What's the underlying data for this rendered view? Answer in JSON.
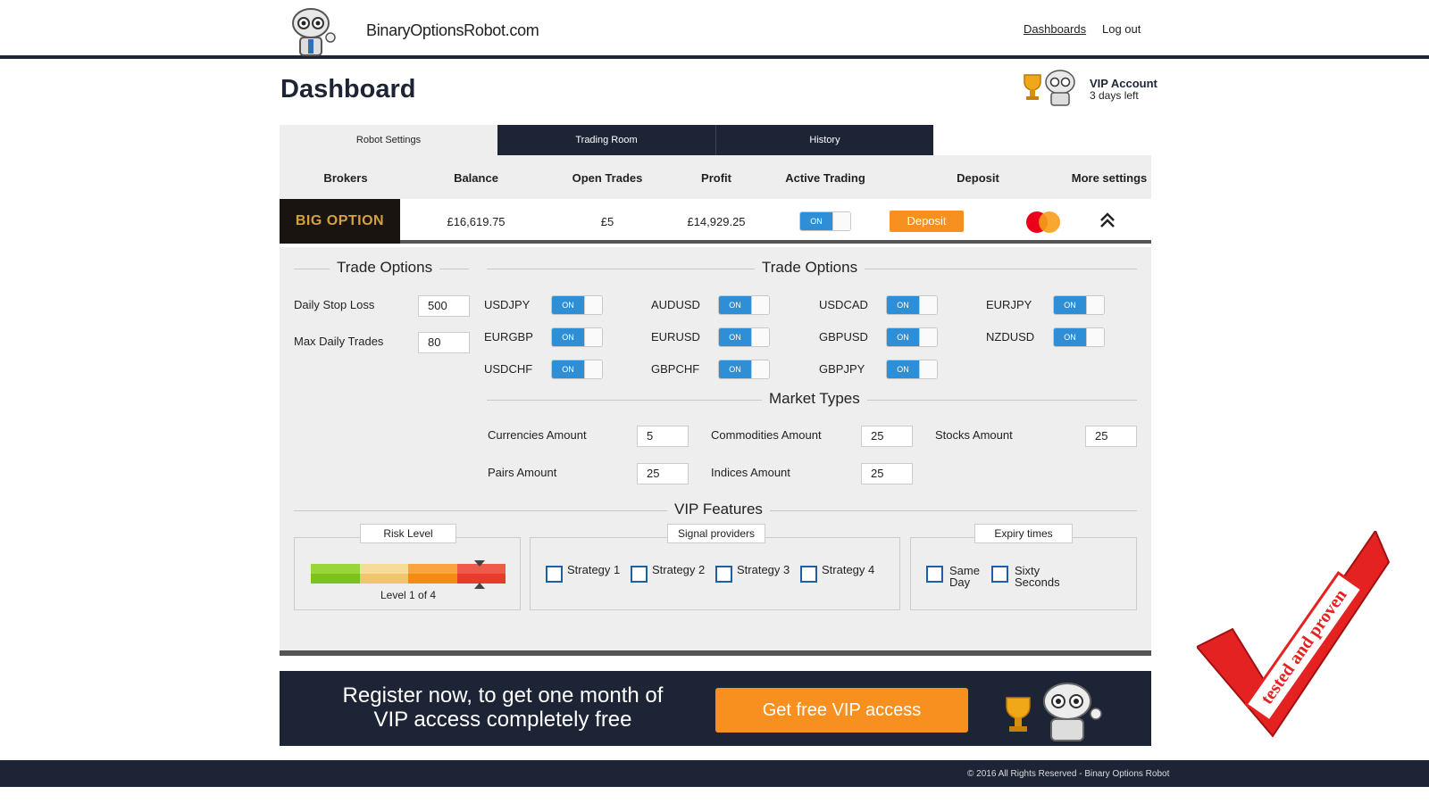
{
  "header": {
    "logo_text": "BinaryOptionsRobot.com",
    "nav": {
      "dashboards": "Dashboards",
      "logout": "Log out"
    }
  },
  "page": {
    "title": "Dashboard",
    "vip_account": "VIP Account",
    "vip_days_left": "3 days left"
  },
  "tabs": [
    "Robot Settings",
    "Trading Room",
    "History"
  ],
  "brokers_table": {
    "headers": [
      "Brokers",
      "Balance",
      "Open Trades",
      "Profit",
      "Active Trading",
      "Deposit",
      "More settings"
    ],
    "row": {
      "broker_name": "BIG OPTION",
      "balance": "£16,619.75",
      "open_trades": "£5",
      "profit": "£14,929.25",
      "active_trading": "ON",
      "deposit_button": "Deposit"
    }
  },
  "trade_options": {
    "title_left": "Trade Options",
    "title_right": "Trade Options",
    "daily_stop_loss_label": "Daily Stop Loss",
    "daily_stop_loss_value": "500",
    "max_daily_trades_label": "Max Daily Trades",
    "max_daily_trades_value": "80",
    "toggle_label": "ON",
    "pairs": [
      "USDJPY",
      "AUDUSD",
      "USDCAD",
      "EURJPY",
      "EURGBP",
      "EURUSD",
      "GBPUSD",
      "NZDUSD",
      "USDCHF",
      "GBPCHF",
      "GBPJPY"
    ]
  },
  "market_types": {
    "title": "Market Types",
    "currencies_label": "Currencies Amount",
    "currencies_value": "5",
    "commodities_label": "Commodities Amount",
    "commodities_value": "25",
    "stocks_label": "Stocks Amount",
    "stocks_value": "25",
    "pairs_label": "Pairs Amount",
    "pairs_value": "25",
    "indices_label": "Indices Amount",
    "indices_value": "25"
  },
  "vip_features": {
    "title": "VIP Features",
    "risk_level_label": "Risk Level",
    "risk_level_text": "Level 1 of 4",
    "risk_level_value": 1,
    "risk_level_max": 4,
    "signal_providers_label": "Signal providers",
    "strategies": [
      "Strategy 1",
      "Strategy 2",
      "Strategy 3",
      "Strategy 4"
    ],
    "expiry_times_label": "Expiry times",
    "expiry_same": "Same",
    "expiry_day": "Day",
    "expiry_sixty": "Sixty",
    "expiry_seconds": "Seconds"
  },
  "banner": {
    "line1": "Register now, to get one month of",
    "line2": "VIP access completely free",
    "cta": "Get free VIP access"
  },
  "footer": {
    "copyright": "© 2016 All Rights Reserved - Binary Options Robot"
  },
  "stamp": {
    "text": "tested and proven"
  },
  "colors": {
    "navy": "#1c2436",
    "orange": "#f7901e",
    "toggle_blue": "#2f8fd6"
  }
}
